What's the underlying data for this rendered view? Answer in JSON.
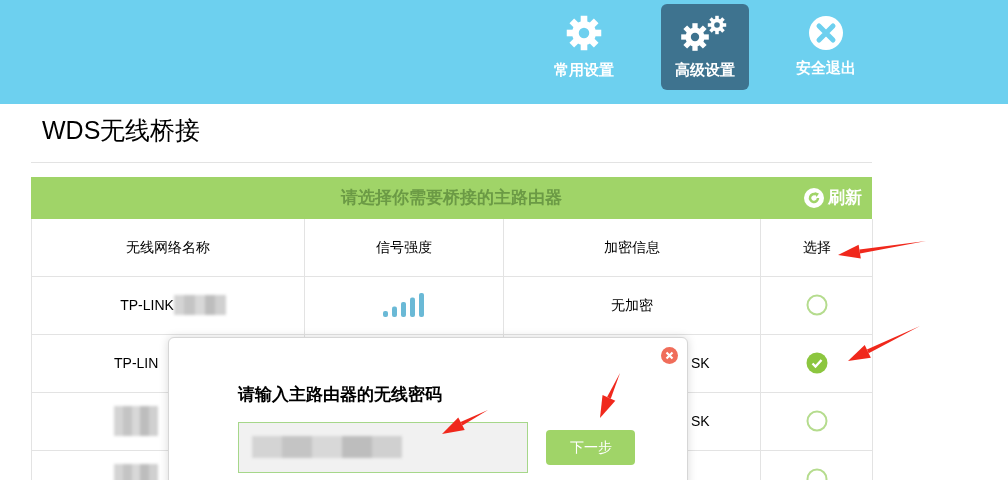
{
  "nav": [
    {
      "label": "常用设置",
      "kind": "gear",
      "selected": false
    },
    {
      "label": "高级设置",
      "kind": "gears",
      "selected": true
    },
    {
      "label": "安全退出",
      "kind": "exit",
      "selected": false
    }
  ],
  "page_title": "WDS无线桥接",
  "table": {
    "banner": "请选择你需要桥接的主路由器",
    "refresh": "刷新",
    "columns": [
      "无线网络名称",
      "信号强度",
      "加密信息",
      "选择"
    ],
    "rows": [
      {
        "name": "TP-LINK",
        "name_redacted": true,
        "signal": true,
        "encryption": "无加密",
        "selected": false
      },
      {
        "name": "TP-LIN",
        "name_redacted": false,
        "signal": false,
        "encryption": "SK",
        "selected": true
      },
      {
        "name_redacted": true,
        "signal": false,
        "encryption": "SK",
        "selected": false
      },
      {
        "name_redacted": true,
        "signal": false,
        "selected": false
      }
    ]
  },
  "dialog": {
    "title": "请输入主路由器的无线密码",
    "password_redacted": true,
    "next": "下一步"
  }
}
